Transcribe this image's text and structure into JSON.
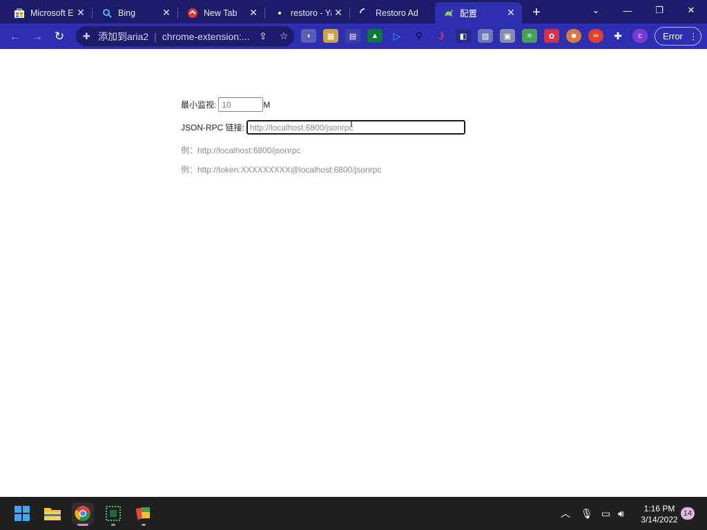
{
  "tabs": [
    {
      "title": "Microsoft E",
      "icon": "store-icon"
    },
    {
      "title": "Bing",
      "icon": "search-icon"
    },
    {
      "title": "New Tab",
      "icon": "opera-icon"
    },
    {
      "title": "restoro - Ya",
      "icon": "yandex-icon"
    },
    {
      "title": "Restoro Ad",
      "icon": "loading-icon"
    },
    {
      "title": "配置",
      "icon": "aria2-icon"
    }
  ],
  "toolbar": {
    "site_name": "添加到aria2",
    "url": "chrome-extension:...",
    "error_label": "Error"
  },
  "settings": {
    "min_monitor_label": "最小监视:",
    "min_monitor_value": "10",
    "min_monitor_unit": "M",
    "rpc_label": "JSON-RPC 链接:",
    "rpc_placeholder": "http://localhost:6800/jsonrpc",
    "example1": "例：http://localhost:6800/jsonrpc",
    "example2": "例：http://token:XXXXXXXXX@localhost:6800/jsonrpc"
  },
  "taskbar": {
    "time": "1:16 PM",
    "date": "3/14/2022",
    "notification_count": "14"
  },
  "colors": {
    "tabstrip": "#1c1c6a",
    "toolbar": "#2e2eb0",
    "taskbar": "#202020"
  }
}
